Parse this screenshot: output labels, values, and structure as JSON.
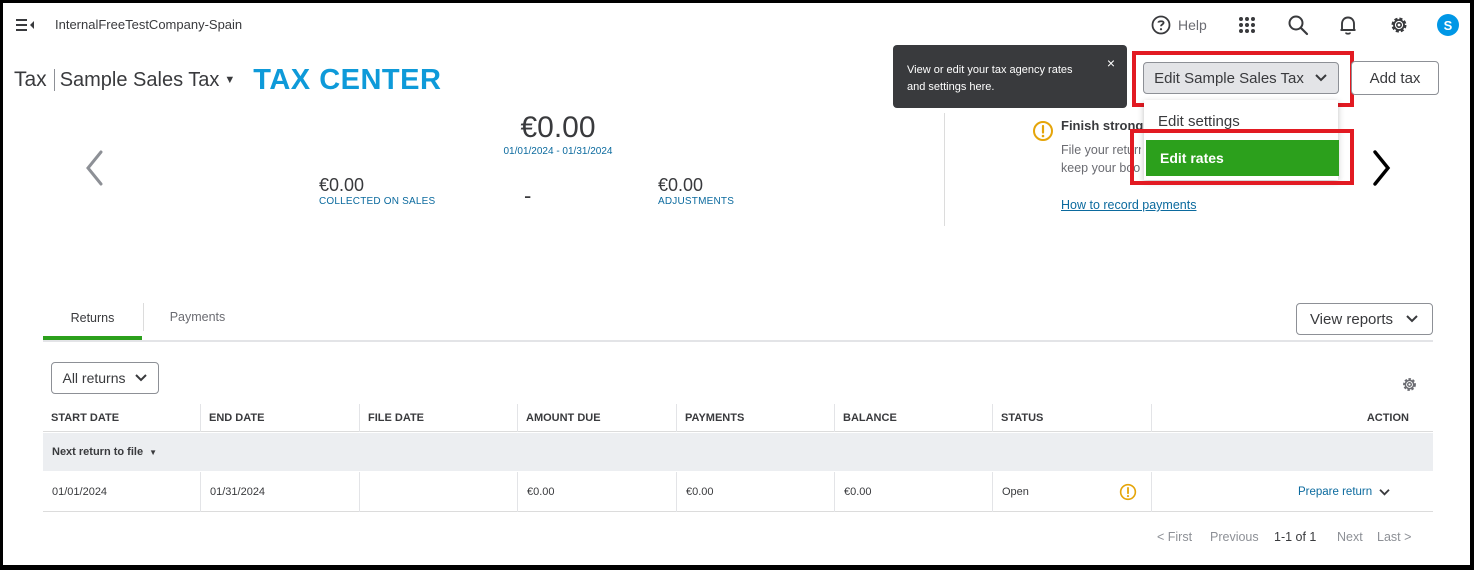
{
  "topbar": {
    "company_name": "InternalFreeTestCompany-Spain",
    "help_label": "Help",
    "avatar_initial": "S"
  },
  "title": {
    "section": "Tax",
    "agency_name": "Sample Sales Tax",
    "overlay_heading": "TAX CENTER"
  },
  "summary": {
    "total": "€0.00",
    "period": "01/01/2024 - 01/31/2024",
    "collected_amount": "€0.00",
    "collected_label": "COLLECTED ON SALES",
    "operator": "-",
    "adjustments_amount": "€0.00",
    "adjustments_label": "ADJUSTMENTS"
  },
  "notice": {
    "title": "Finish strong.",
    "line1": "File your return",
    "line2": "keep your books",
    "link": "How to record payments"
  },
  "tooltip": {
    "text": "View or edit your tax agency rates and settings here.",
    "close": "×"
  },
  "actions": {
    "edit_button": "Edit Sample Sales Tax",
    "add_tax_button": "Add tax",
    "dropdown": [
      {
        "label": "Edit settings"
      },
      {
        "label": "Edit rates"
      }
    ]
  },
  "tabs": [
    {
      "label": "Returns"
    },
    {
      "label": "Payments"
    }
  ],
  "view_reports": "View reports",
  "filter": {
    "selected": "All returns"
  },
  "table": {
    "columns": [
      "START DATE",
      "END DATE",
      "FILE DATE",
      "AMOUNT DUE",
      "PAYMENTS",
      "BALANCE",
      "STATUS",
      "ACTION"
    ],
    "group_label": "Next return to file",
    "rows": [
      {
        "start_date": "01/01/2024",
        "end_date": "01/31/2024",
        "file_date": "",
        "amount_due": "€0.00",
        "payments": "€0.00",
        "balance": "€0.00",
        "status": "Open",
        "action": "Prepare return"
      }
    ]
  },
  "pagination": {
    "first": "< First",
    "previous": "Previous",
    "range": "1-1 of 1",
    "next": "Next",
    "last": "Last >"
  },
  "colors": {
    "accent_green": "#2ca01c",
    "link_blue": "#0b6a9e",
    "heading_blue": "#0e9ad9",
    "highlight_red": "#e21a22",
    "warning_yellow": "#e5a50a"
  }
}
